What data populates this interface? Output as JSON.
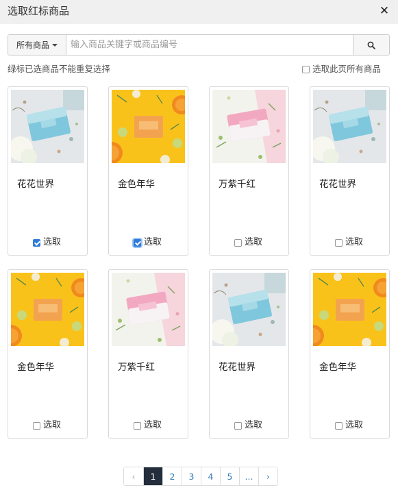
{
  "dialog": {
    "title": "选取红标商品",
    "close_icon": "close-icon"
  },
  "search": {
    "scope_label": "所有商品",
    "placeholder": "输入商品关键字或商品编号",
    "button_icon": "search-icon"
  },
  "hint_text": "绿标已选商品不能重复选择",
  "select_page_label": "选取此页所有商品",
  "products": [
    {
      "name": "花花世界",
      "select_label": "选取",
      "checked": true,
      "thumb": "blue-soap"
    },
    {
      "name": "金色年华",
      "select_label": "选取",
      "checked": true,
      "thumb": "yellow-soap"
    },
    {
      "name": "万紫千红",
      "select_label": "选取",
      "checked": false,
      "thumb": "pink-soap"
    },
    {
      "name": "花花世界",
      "select_label": "选取",
      "checked": false,
      "thumb": "blue-soap"
    },
    {
      "name": "金色年华",
      "select_label": "选取",
      "checked": false,
      "thumb": "yellow-soap"
    },
    {
      "name": "万紫千红",
      "select_label": "选取",
      "checked": false,
      "thumb": "pink-soap"
    },
    {
      "name": "花花世界",
      "select_label": "选取",
      "checked": false,
      "thumb": "blue-soap"
    },
    {
      "name": "金色年华",
      "select_label": "选取",
      "checked": false,
      "thumb": "yellow-soap"
    }
  ],
  "pagination": {
    "prev": "‹",
    "pages": [
      "1",
      "2",
      "3",
      "4",
      "5",
      "..."
    ],
    "active": "1",
    "next": "›"
  },
  "colors": {
    "accent": "#2f7cd8",
    "active_page": "#232d3b",
    "link": "#337ab7"
  }
}
